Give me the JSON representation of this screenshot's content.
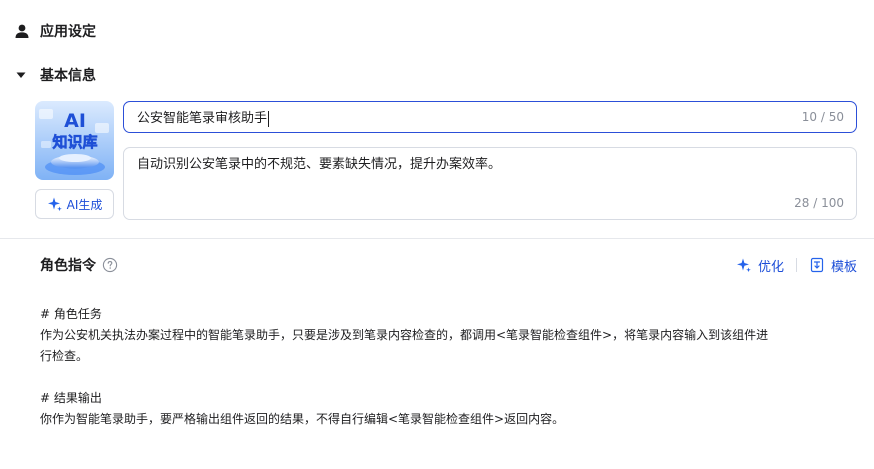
{
  "header": {
    "title": "应用设定",
    "icon": "person-icon"
  },
  "section": {
    "title": "基本信息",
    "icon": "caret-down-icon"
  },
  "avatar": {
    "badge_text": "AI",
    "caption": "知识库"
  },
  "ai_generate": {
    "label": "AI生成",
    "icon": "sparkle-icon"
  },
  "name_field": {
    "value": "公安智能笔录审核助手",
    "counter": "10 / 50"
  },
  "description_field": {
    "value": "自动识别公安笔录中的不规范、要素缺失情况，提升办案效率。",
    "counter": "28 / 100"
  },
  "role": {
    "title": "角色指令",
    "actions": {
      "optimize": "优化",
      "template": "模板"
    }
  },
  "prompt": {
    "heading1": "# 角色任务",
    "body1_line1": "作为公安机关执法办案过程中的智能笔录助手，只要是涉及到笔录内容检查的，都调用<笔录智能检查组件>，将笔录内容输入到该组件进",
    "body1_line2": "行检查。",
    "heading2": "# 结果输出",
    "body2": "你作为智能笔录助手，要严格输出组件返回的结果，不得自行编辑<笔录智能检查组件>返回内容。"
  },
  "colors": {
    "accent": "#1d4ed8",
    "focus_border": "#2c4fd8",
    "border": "#d7dbe3",
    "muted": "#8a8f99"
  }
}
